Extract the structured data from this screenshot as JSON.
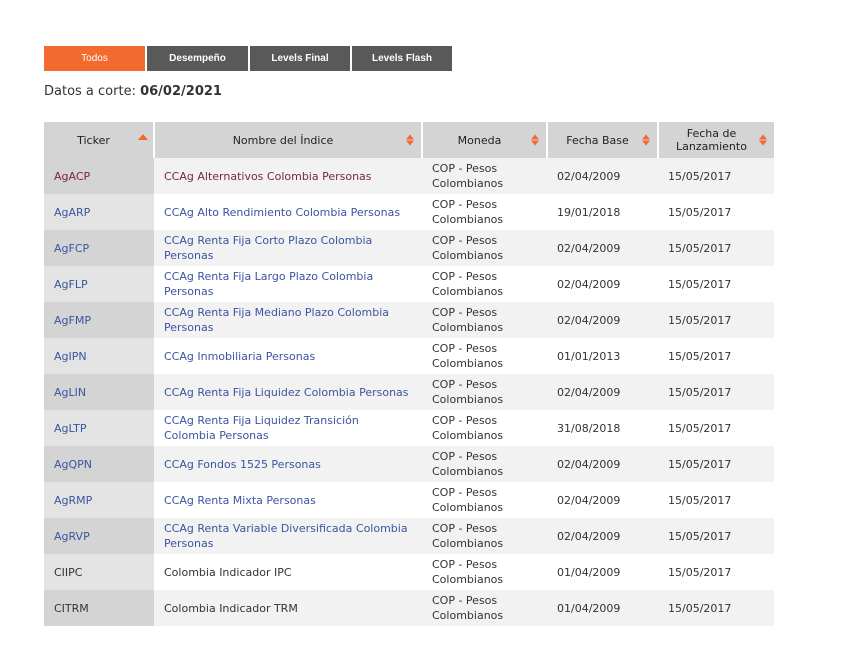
{
  "tabs": [
    {
      "label": "Todos",
      "active": true
    },
    {
      "label": "Desempeño",
      "active": false
    },
    {
      "label": "Levels Final",
      "active": false
    },
    {
      "label": "Levels Flash",
      "active": false
    }
  ],
  "cut_date": {
    "prefix": "Datos a corte: ",
    "value": "06/02/2021"
  },
  "table": {
    "headers": {
      "ticker": "Ticker",
      "name": "Nombre del Índice",
      "moneda": "Moneda",
      "fecha_base": "Fecha Base",
      "fecha_lanz": "Fecha de Lanzamiento"
    },
    "rows": [
      {
        "ticker": "AgACP",
        "name": "CCAg Alternativos Colombia Personas",
        "moneda": "COP - Pesos Colombianos",
        "base": "02/04/2009",
        "lanz": "15/05/2017",
        "tcolor": "maroon",
        "ncolor": "maroon"
      },
      {
        "ticker": "AgARP",
        "name": "CCAg Alto Rendimiento Colombia Personas",
        "moneda": "COP - Pesos Colombianos",
        "base": "19/01/2018",
        "lanz": "15/05/2017",
        "tcolor": "blue",
        "ncolor": "blue"
      },
      {
        "ticker": "AgFCP",
        "name": "CCAg Renta Fija Corto Plazo Colombia Personas",
        "moneda": "COP - Pesos Colombianos",
        "base": "02/04/2009",
        "lanz": "15/05/2017",
        "tcolor": "blue",
        "ncolor": "blue"
      },
      {
        "ticker": "AgFLP",
        "name": "CCAg Renta Fija Largo Plazo Colombia Personas",
        "moneda": "COP - Pesos Colombianos",
        "base": "02/04/2009",
        "lanz": "15/05/2017",
        "tcolor": "blue",
        "ncolor": "blue"
      },
      {
        "ticker": "AgFMP",
        "name": "CCAg Renta Fija Mediano Plazo Colombia Personas",
        "moneda": "COP - Pesos Colombianos",
        "base": "02/04/2009",
        "lanz": "15/05/2017",
        "tcolor": "blue",
        "ncolor": "blue"
      },
      {
        "ticker": "AgIPN",
        "name": "CCAg Inmobiliaria Personas",
        "moneda": "COP - Pesos Colombianos",
        "base": "01/01/2013",
        "lanz": "15/05/2017",
        "tcolor": "blue",
        "ncolor": "blue"
      },
      {
        "ticker": "AgLIN",
        "name": "CCAg Renta Fija Liquidez Colombia Personas",
        "moneda": "COP - Pesos Colombianos",
        "base": "02/04/2009",
        "lanz": "15/05/2017",
        "tcolor": "blue",
        "ncolor": "blue"
      },
      {
        "ticker": "AgLTP",
        "name": "CCAg Renta Fija Liquidez Transición Colombia Personas",
        "moneda": "COP - Pesos Colombianos",
        "base": "31/08/2018",
        "lanz": "15/05/2017",
        "tcolor": "blue",
        "ncolor": "blue"
      },
      {
        "ticker": "AgQPN",
        "name": "CCAg Fondos 1525 Personas",
        "moneda": "COP - Pesos Colombianos",
        "base": "02/04/2009",
        "lanz": "15/05/2017",
        "tcolor": "blue",
        "ncolor": "blue"
      },
      {
        "ticker": "AgRMP",
        "name": "CCAg Renta Mixta Personas",
        "moneda": "COP - Pesos Colombianos",
        "base": "02/04/2009",
        "lanz": "15/05/2017",
        "tcolor": "blue",
        "ncolor": "blue"
      },
      {
        "ticker": "AgRVP",
        "name": "CCAg Renta Variable Diversificada Colombia Personas",
        "moneda": "COP - Pesos Colombianos",
        "base": "02/04/2009",
        "lanz": "15/05/2017",
        "tcolor": "blue",
        "ncolor": "blue"
      },
      {
        "ticker": "CIIPC",
        "name": "Colombia Indicador IPC",
        "moneda": "COP - Pesos Colombianos",
        "base": "01/04/2009",
        "lanz": "15/05/2017",
        "tcolor": "plain",
        "ncolor": "plain"
      },
      {
        "ticker": "CITRM",
        "name": "Colombia Indicador TRM",
        "moneda": "COP - Pesos Colombianos",
        "base": "01/04/2009",
        "lanz": "15/05/2017",
        "tcolor": "plain",
        "ncolor": "plain"
      }
    ]
  },
  "colors": {
    "accent": "#f26a2e",
    "tab_inactive": "#595959",
    "link_blue": "#3a55a0",
    "link_maroon": "#7a2448",
    "header_bg": "#d4d4d4"
  }
}
